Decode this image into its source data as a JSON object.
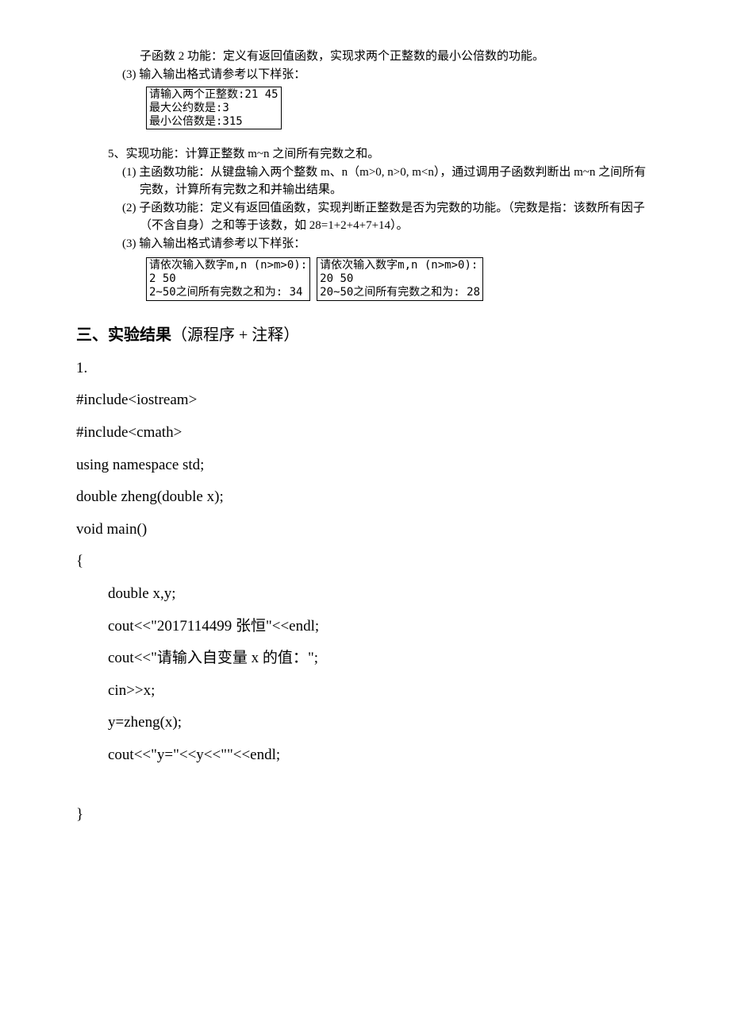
{
  "top": {
    "subfunc2": "子函数 2 功能：定义有返回值函数，实现求两个正整数的最小公倍数的功能。",
    "io3": "(3) 输入输出格式请参考以下样张：",
    "box1_l1": "请输入两个正整数:21 45",
    "box1_l2": "最大公约数是:3",
    "box1_l3": "最小公倍数是:315"
  },
  "q5": {
    "title": "5、实现功能：计算正整数 m~n 之间所有完数之和。",
    "p1": "(1) 主函数功能：从键盘输入两个整数 m、n（m>0, n>0, m<n），通过调用子函数判断出 m~n 之间所有完数，计算所有完数之和并输出结果。",
    "p2": "(2) 子函数功能：定义有返回值函数，实现判断正整数是否为完数的功能。（完数是指：该数所有因子（不含自身）之和等于该数，如 28=1+2+4+7+14）。",
    "p3": "(3) 输入输出格式请参考以下样张：",
    "boxA_l1": "请依次输入数字m,n (n>m>0):",
    "boxA_l2": "2 50",
    "boxA_l3": "2~50之间所有完数之和为: 34",
    "boxB_l1": "请依次输入数字m,n (n>m>0):",
    "boxB_l2": "20 50",
    "boxB_l3": "20~50之间所有完数之和为: 28"
  },
  "section": {
    "heading_main": "三、实验结果",
    "heading_paren": "（源程序 + 注释）"
  },
  "code": {
    "num": "1.",
    "l1": "#include<iostream>",
    "l2": "#include<cmath>",
    "l3": "using namespace std;",
    "l4": "double zheng(double x);",
    "l5": "void main()",
    "l6": "{",
    "l7": "double x,y;",
    "l8a": "cout<<\"2017114499  ",
    "l8b": "张恒",
    "l8c": "\"<<endl;",
    "l9a": "cout<<\"",
    "l9b": "请输入自变量 ",
    "l9c": "x ",
    "l9d": "的值：",
    "l9e": "\";",
    "l10": "cin>>x;",
    "l11": "y=zheng(x);",
    "l12": "cout<<\"y=\"<<y<<\"\"<<endl;",
    "l13": "}"
  }
}
